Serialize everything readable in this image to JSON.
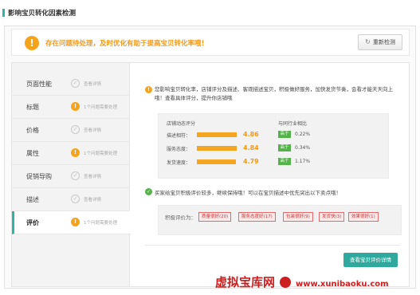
{
  "page": {
    "title": "影响宝贝转化因素检测"
  },
  "alert": {
    "message": "存在问题待处理，及时优化有助于提高宝贝转化率哦！",
    "recheck_label": "重新检测"
  },
  "sidebar": {
    "items": [
      {
        "label": "页面性能",
        "status": "ok",
        "status_text": "查看详情"
      },
      {
        "label": "标题",
        "status": "warn",
        "status_text": "1个问题需要处理"
      },
      {
        "label": "价格",
        "status": "ok",
        "status_text": "查看详情"
      },
      {
        "label": "属性",
        "status": "warn",
        "status_text": "1个问题需要处理"
      },
      {
        "label": "促销导购",
        "status": "ok",
        "status_text": "查看详情"
      },
      {
        "label": "描述",
        "status": "ok",
        "status_text": "查看详情"
      },
      {
        "label": "评价",
        "status": "warn",
        "status_text": "1个问题需要处理",
        "active": true
      }
    ]
  },
  "content": {
    "intro": "您影响宝贝转化率，店铺评分及描述、客观描述宝贝，积极做好服务，加快发货节奏，会看才能天天向上哦！查看具体评分，提升你店铺哦",
    "dsr": {
      "col1": "店铺动态评分",
      "col2": "与同行业相比",
      "rows": [
        {
          "name": "描述相符：",
          "score": "4.86",
          "fill": 0.97,
          "tag": "高于",
          "pct": "0.22%"
        },
        {
          "name": "服务态度：",
          "score": "4.84",
          "fill": 0.96,
          "tag": "高于",
          "pct": "0.34%"
        },
        {
          "name": "发货速度：",
          "score": "4.79",
          "fill": 0.94,
          "tag": "高于",
          "pct": "1.17%"
        }
      ]
    },
    "good_note": "买家给宝贝积极评价较多，继续保持哦！可以在宝贝描述中优先突出以下卖点哦！",
    "praise_label": "积极评价为：",
    "praise_tags": [
      "质量很好(20)",
      "服务态度好(17)",
      "包装很好(9)",
      "发货快(3)",
      "效果很好(1)"
    ],
    "cta_label": "查看宝贝评价详情"
  },
  "watermark": {
    "text": "虚拟宝库网",
    "url": "www.xunibaoku.com"
  },
  "colors": {
    "accent": "#2fb3a7",
    "warning": "#f5a31a",
    "success": "#55b24a",
    "danger": "#cc1e1e"
  }
}
